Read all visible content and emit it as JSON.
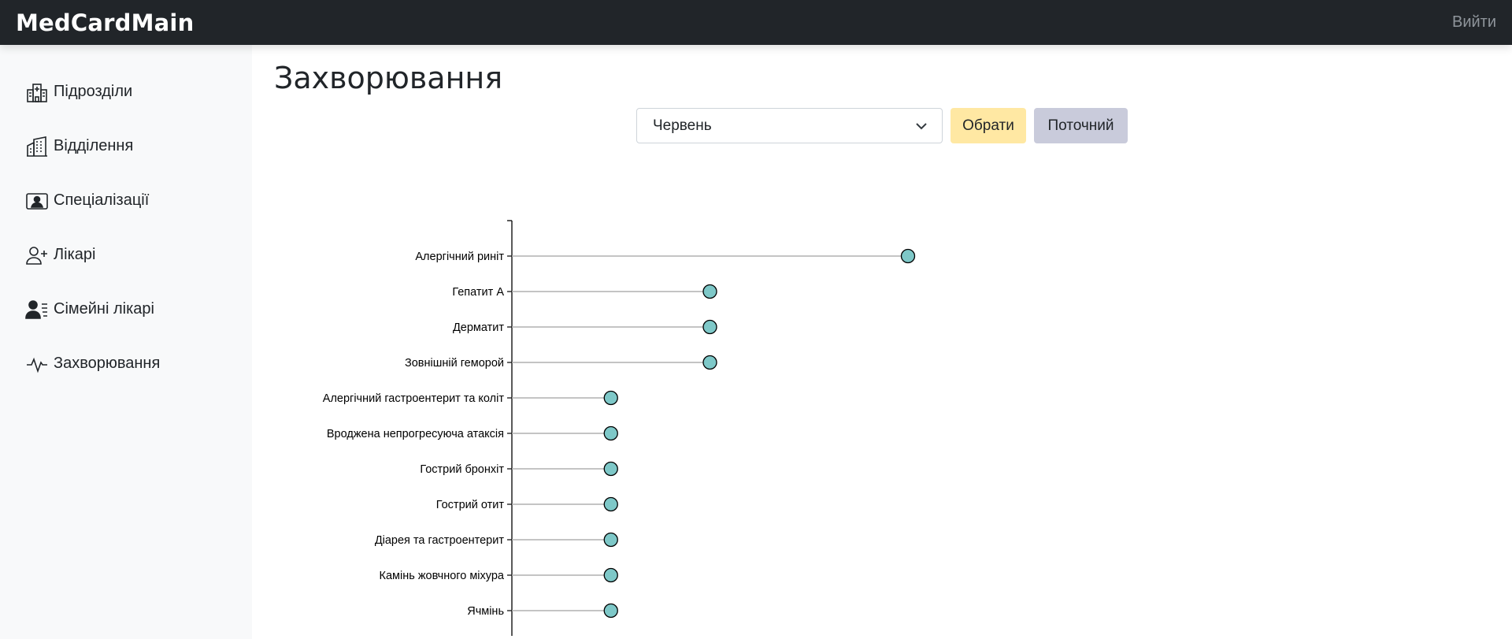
{
  "navbar": {
    "brand": "MedCardMain",
    "logout": "Вийти"
  },
  "sidebar": {
    "items": [
      {
        "label": "Підрозділи",
        "icon": "hospital-icon"
      },
      {
        "label": "Відділення",
        "icon": "buildings-icon"
      },
      {
        "label": "Спеціалізації",
        "icon": "badge-person-icon"
      },
      {
        "label": "Лікарі",
        "icon": "person-plus-icon"
      },
      {
        "label": "Сімейні лікарі",
        "icon": "person-lines-icon"
      },
      {
        "label": "Захворювання",
        "icon": "pulse-icon"
      }
    ]
  },
  "main": {
    "title": "Захворювання",
    "month_select": {
      "value": "Червень"
    },
    "choose_label": "Обрати",
    "current_label": "Поточний"
  },
  "colors": {
    "marker": "#7ec8c8",
    "stem": "#b0b0b0",
    "axis": "#000000"
  },
  "chart_data": {
    "type": "lollipop",
    "orientation": "horizontal",
    "categories": [
      "Алергічний риніт",
      "Гепатит А",
      "Дерматит",
      "Зовнішній геморой",
      "Алергічний гастроентерит та коліт",
      "Вроджена непрогресуюча атаксія",
      "Гострий бронхіт",
      "Гострий отит",
      "Діарея та гастроентерит",
      "Камінь жовчного міхура",
      "Ячмінь"
    ],
    "values": [
      4,
      2,
      2,
      2,
      1,
      1,
      1,
      1,
      1,
      1,
      1
    ],
    "xlim": [
      0,
      4
    ],
    "xticks": [
      "0.0",
      "0.5",
      "1.0",
      "1.5",
      "2.0",
      "2.5",
      "3.0",
      "3.5",
      "4.0"
    ],
    "grid": false
  }
}
